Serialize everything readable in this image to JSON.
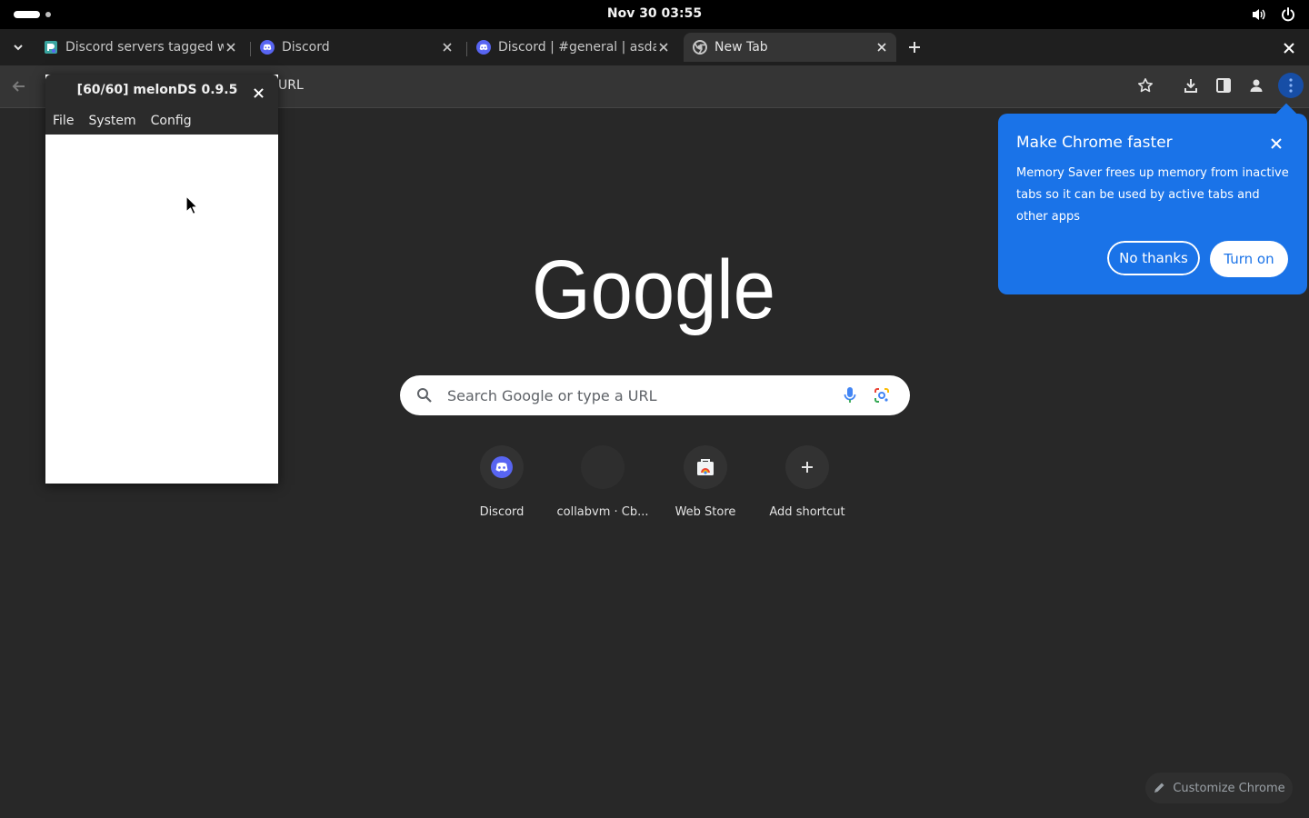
{
  "topbar": {
    "clock": "Nov 30  03:55",
    "icons": [
      "activities-indicator",
      "volume-icon",
      "power-icon"
    ]
  },
  "tabs": [
    {
      "title": "Discord servers tagged w",
      "favicon": "disboard-icon",
      "active": false
    },
    {
      "title": "Discord",
      "favicon": "discord-icon",
      "active": false
    },
    {
      "title": "Discord | #general | asda",
      "favicon": "discord-icon",
      "active": false
    },
    {
      "title": "New Tab",
      "favicon": "chrome-icon",
      "active": true
    }
  ],
  "toolbar": {
    "omnibox_text": "URL",
    "icons": [
      "back-icon",
      "bookmark-star-icon",
      "download-icon",
      "side-panel-icon",
      "profile-icon",
      "more-vert-icon"
    ]
  },
  "ntp": {
    "logo_text": "Google",
    "search_placeholder": "Search Google or type a URL",
    "shortcuts": [
      {
        "label": "Discord",
        "icon": "discord-icon"
      },
      {
        "label": "collabvm · Cb...",
        "icon": "blank-icon"
      },
      {
        "label": "Web Store",
        "icon": "web-store-icon"
      },
      {
        "label": "Add shortcut",
        "icon": "plus-icon"
      }
    ],
    "customize_label": "Customize Chrome"
  },
  "promo": {
    "title": "Make Chrome faster",
    "body": "Memory Saver frees up memory from inactive tabs so it can be used by active tabs and other apps",
    "no_thanks": "No thanks",
    "turn_on": "Turn on"
  },
  "melon": {
    "title": "[60/60] melonDS 0.9.5",
    "menu": [
      "File",
      "System",
      "Config"
    ]
  },
  "colors": {
    "accent": "#1a73e8",
    "page_bg": "#282828",
    "toolbar_bg": "#353535",
    "tabstrip_bg": "#1f1f1f"
  }
}
